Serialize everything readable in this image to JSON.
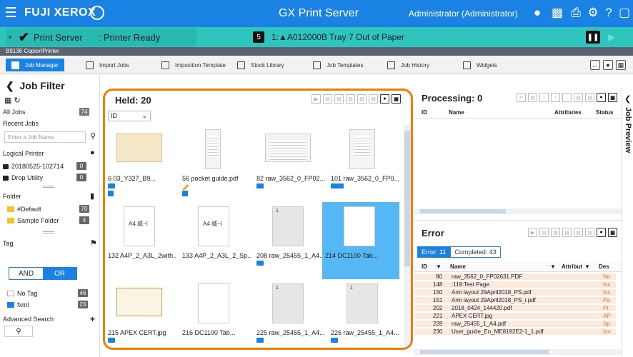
{
  "header": {
    "brand": "FUJI XEROX",
    "app_title": "GX Print Server",
    "user": "Administrator (Administrator)"
  },
  "status": {
    "server_label": "Print Server",
    "server_value": ": Printer Ready",
    "count": "5",
    "message": "1:▲A012000B Tray 7 Out of Paper"
  },
  "printer": {
    "name": "B9136 Copier/Printer"
  },
  "menu": {
    "tabs": [
      "Job Manager",
      "Import Jobs",
      "Imposition Template",
      "Stock Library",
      "Job Templates",
      "Job History",
      "Widgets"
    ],
    "more": "..."
  },
  "filter": {
    "title": "Job Filter",
    "all_jobs": "All Jobs",
    "all_jobs_count": "74",
    "recent_jobs": "Recent Jobs",
    "search_placeholder": "Enter a Job Name",
    "logical_printer": "Logical Printer",
    "printer1": "20180525-102714",
    "printer1_count": "0",
    "printer2": "Drop Utility",
    "printer2_count": "0",
    "folder": "Folder",
    "folder1": "#Default",
    "folder1_count": "70",
    "folder2": "Sample Folder",
    "folder2_count": "4",
    "tag": "Tag",
    "and": "AND",
    "or": "OR",
    "no_tag": "No Tag",
    "no_tag_count": "46",
    "fxml": "fxml",
    "fxml_count": "23",
    "advanced_search": "Advanced Search"
  },
  "held": {
    "title": "Held: 20",
    "sort": "ID",
    "tiles": [
      {
        "name": "6  03_Y327_B9..."
      },
      {
        "name": "56  pocket guide.pdf"
      },
      {
        "name": "82  raw_3562_0_FP02..."
      },
      {
        "name": "101  raw_3562_0_FP0..."
      },
      {
        "name": "132  A4P_2_A3L_2with..."
      },
      {
        "name": "133  A4P_2_A3L_2_Sp..."
      },
      {
        "name": "208  raw_25455_1_A4..."
      },
      {
        "name": "214  DC1100 Tab..."
      },
      {
        "name": "215  APEX CERT.jpg"
      },
      {
        "name": "216  DC1100 Tab..."
      },
      {
        "name": "225  raw_25455_1_A4..."
      },
      {
        "name": "226  raw_25455_1_A4..."
      }
    ],
    "thumb_labels": {
      "a4": "A4 威−I",
      "num": "1"
    }
  },
  "processing": {
    "title": "Processing: 0",
    "columns": [
      "ID",
      "Name",
      "Attributes",
      "Status"
    ]
  },
  "error": {
    "title": "Error",
    "tab_error": "Error: 11",
    "tab_completed": "Completed: 43",
    "columns": [
      "ID",
      "Name",
      "Attribut",
      "Des"
    ],
    "rows": [
      {
        "id": "80",
        "name": "raw_3562_0_FP02631.PDF",
        "desc": "No"
      },
      {
        "id": "148",
        "name": ":119:Test Page",
        "desc": "Inc"
      },
      {
        "id": "150",
        "name": "Arm layout 29April2018_PS.pdf",
        "desc": "Inc"
      },
      {
        "id": "151",
        "name": "Arm layout 29April2018_PS_i.pdf",
        "desc": "Pa"
      },
      {
        "id": "202",
        "name": "2018_0424_144420.pdf",
        "desc": "Pr"
      },
      {
        "id": "221",
        "name": "APEX CERT.jpg",
        "desc": "AP"
      },
      {
        "id": "228",
        "name": "raw_25455_1_A4.pdf",
        "desc": "Sp"
      },
      {
        "id": "230",
        "name": "User_guide_En_ME8192E2-1_1.pdf",
        "desc": "Inv"
      }
    ]
  },
  "preview": {
    "label": "Job Preview"
  }
}
